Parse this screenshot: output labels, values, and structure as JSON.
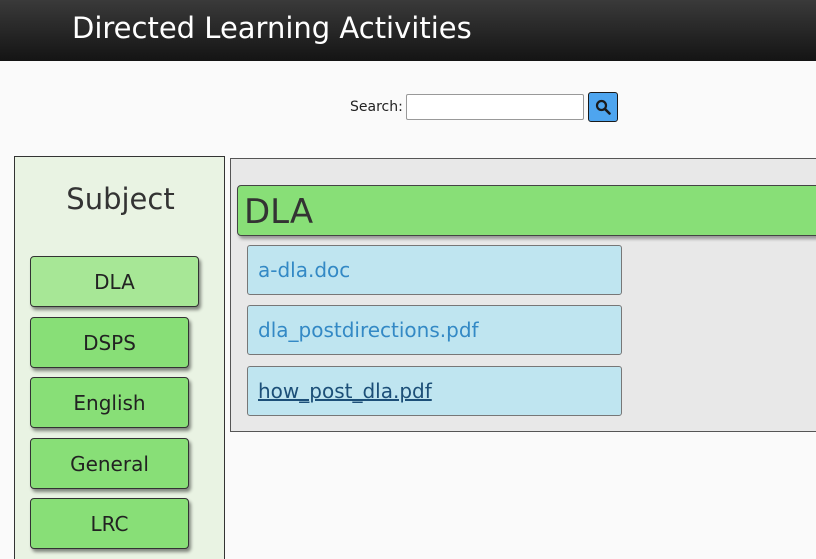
{
  "header": {
    "title": "Directed Learning Activities"
  },
  "search": {
    "label": "Search:",
    "value": "",
    "button_icon": "magnifier-icon"
  },
  "sidebar": {
    "title": "Subject",
    "items": [
      {
        "label": "DLA",
        "active": true
      },
      {
        "label": "DSPS",
        "active": false
      },
      {
        "label": "English",
        "active": false
      },
      {
        "label": "General",
        "active": false
      },
      {
        "label": "LRC",
        "active": false
      }
    ]
  },
  "content": {
    "category": "DLA",
    "files": [
      {
        "name": "a-dla.doc"
      },
      {
        "name": "dla_postdirections.pdf"
      },
      {
        "name": "how_post_dla.pdf"
      }
    ]
  },
  "colors": {
    "header_bg": "#1f1f1f",
    "subject_green": "#88df77",
    "subject_active": "#a7e796",
    "file_bg": "#bfe5f0",
    "link_blue": "#3389c5",
    "search_button": "#4ea5ef"
  }
}
